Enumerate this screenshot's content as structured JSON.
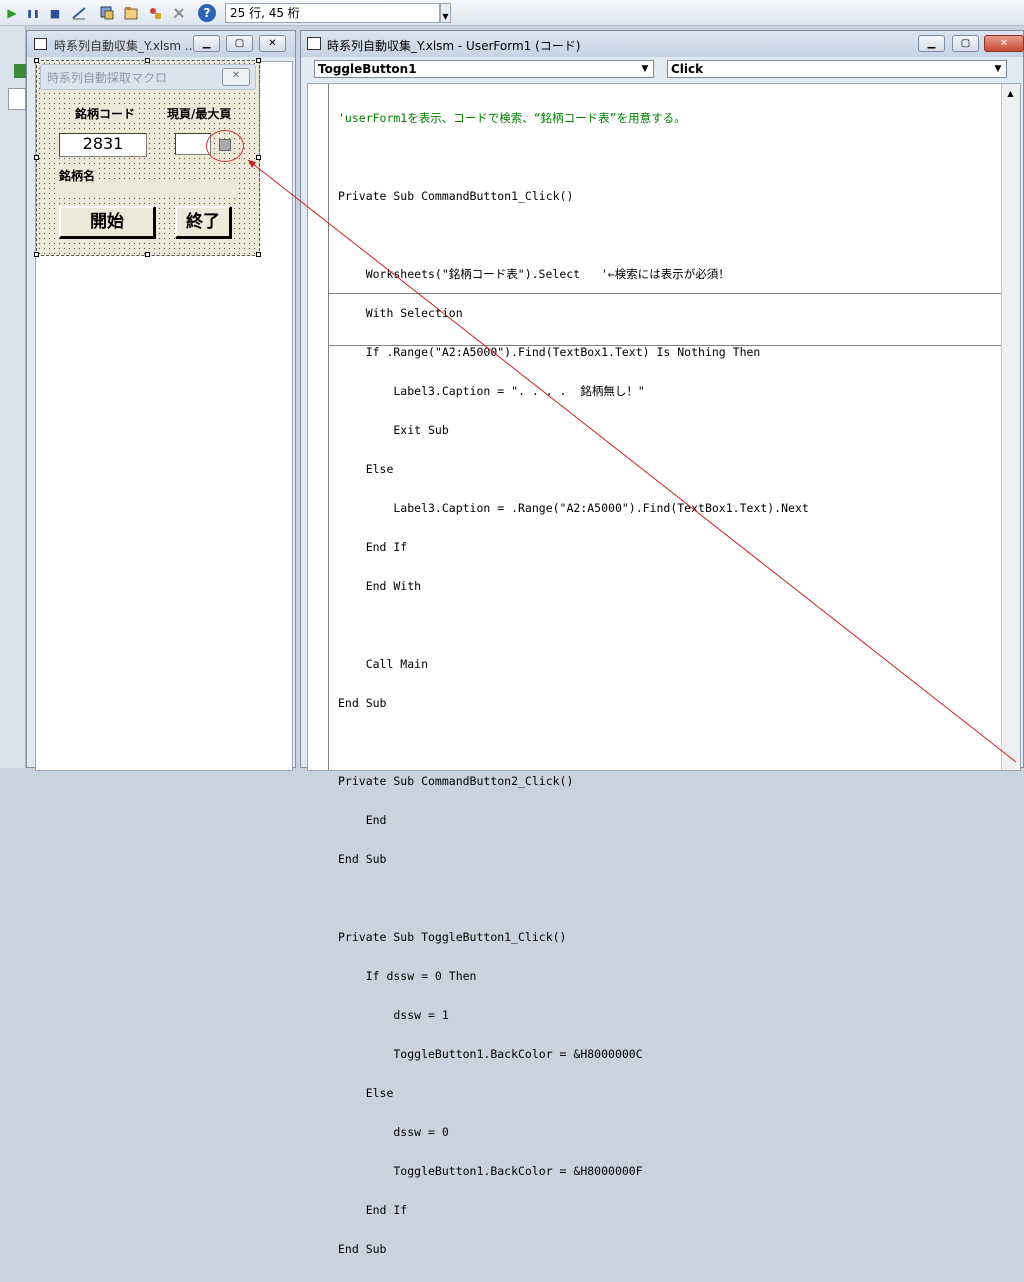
{
  "toolbar": {
    "run_icon": "▶",
    "pause_icon": "❚❚",
    "stop_icon": "■",
    "status": "25 行, 45 桁",
    "help_icon": "?"
  },
  "designer": {
    "title": "時系列自動収集_Y.xlsm ...",
    "form": {
      "title": "時系列自動採取マクロ",
      "label_code": "銘柄コード",
      "label_page": "現頁/最大頁",
      "code_value": "2831",
      "label_name": "銘柄名",
      "start_button": "開始",
      "end_button": "終了"
    }
  },
  "codewin": {
    "title": "時系列自動収集_Y.xlsm - UserForm1 (コード)",
    "object_combo": "ToggleButton1",
    "proc_combo": "Click",
    "lines": [
      "'userForm1を表示、コードで検索、“銘柄コード表”を用意する。",
      "",
      "Private Sub CommandButton1_Click()",
      "",
      "    Worksheets(\"銘柄コード表\").Select   '←検索には表示が必須！",
      "    With Selection",
      "    If .Range(\"A2:A5000\").Find(TextBox1.Text) Is Nothing Then",
      "        Label3.Caption = \". . . .  銘柄無し！\"",
      "        Exit Sub",
      "    Else",
      "        Label3.Caption = .Range(\"A2:A5000\").Find(TextBox1.Text).Next",
      "    End If",
      "    End With",
      "",
      "    Call Main",
      "End Sub",
      "",
      "Private Sub CommandButton2_Click()",
      "    End",
      "End Sub",
      "",
      "Private Sub ToggleButton1_Click()",
      "    If dssw = 0 Then",
      "        dssw = 1",
      "        ToggleButton1.BackColor = &H8000000C",
      "    Else",
      "        dssw = 0",
      "        ToggleButton1.BackColor = &H8000000F",
      "    End If",
      "End Sub"
    ]
  }
}
